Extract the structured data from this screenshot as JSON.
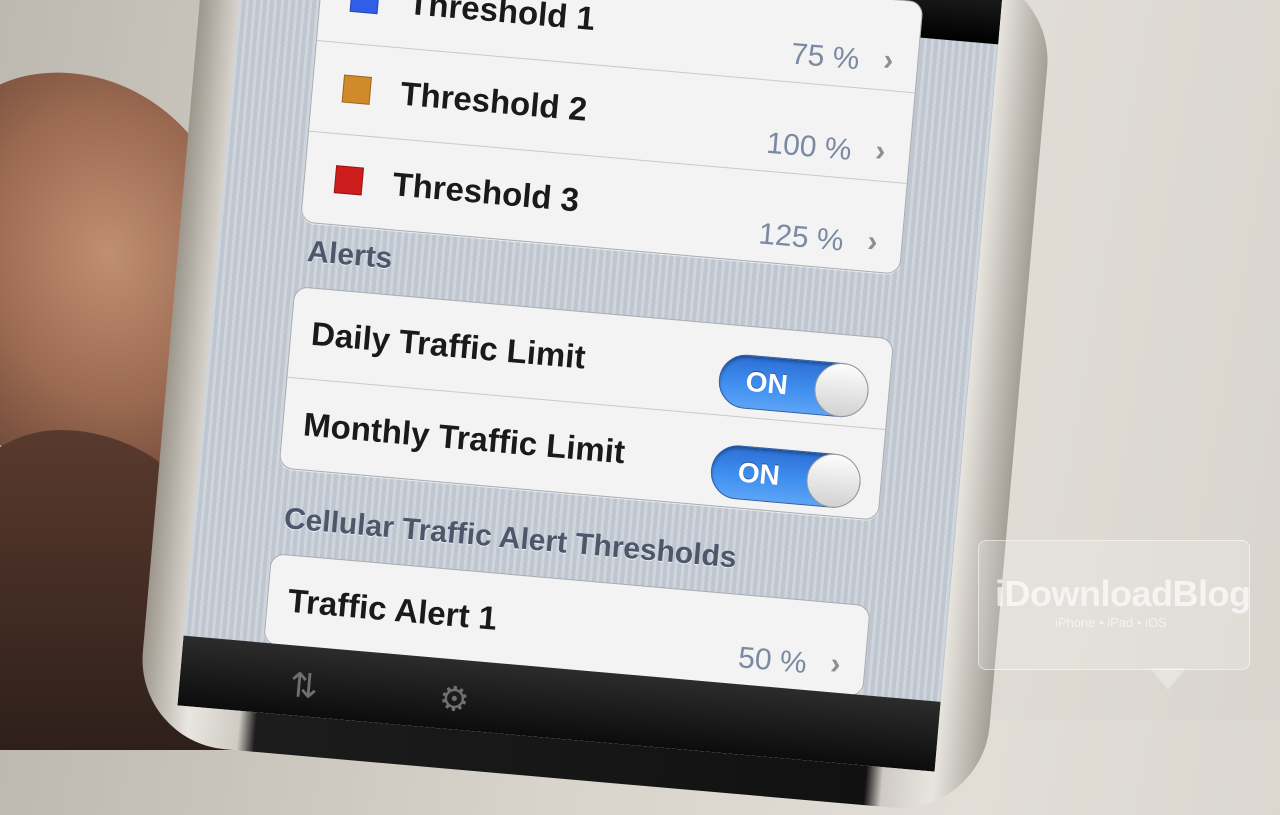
{
  "thresholds": [
    {
      "label": "Threshold 1",
      "value": "75 %",
      "color": "#2f5ee8"
    },
    {
      "label": "Threshold 2",
      "value": "100 %",
      "color": "#d08a2a"
    },
    {
      "label": "Threshold 3",
      "value": "125 %",
      "color": "#cc1c1c"
    }
  ],
  "alerts": {
    "section_title": "Alerts",
    "daily_label": "Daily Traffic Limit",
    "daily_toggle": "ON",
    "monthly_label": "Monthly Traffic Limit",
    "monthly_toggle": "ON"
  },
  "cellular": {
    "section_title": "Cellular Traffic Alert Thresholds",
    "alert1_label": "Traffic Alert 1",
    "alert1_value": "50 %"
  },
  "watermark": {
    "title": "iDownloadBlog",
    "subtitle": "iPhone • iPad • iOS"
  },
  "icons": {
    "chevron": "›",
    "tab1": "arrows-icon",
    "tab2": "gear-icon"
  }
}
